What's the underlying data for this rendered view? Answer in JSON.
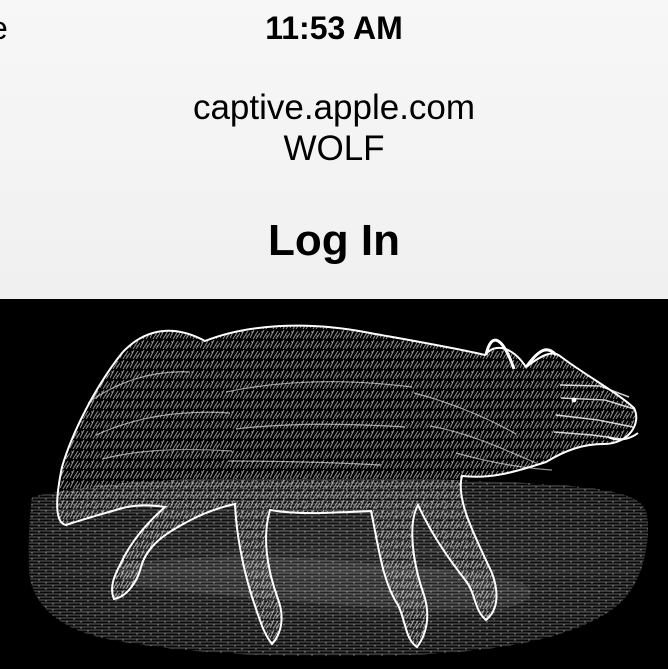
{
  "status_bar": {
    "time": "11:53 AM",
    "left_clip": "e"
  },
  "portal": {
    "domain": "captive.apple.com",
    "network_name": "WOLF",
    "title": "Log In",
    "back_icon": "chevron-left-icon"
  },
  "page_image": {
    "subject": "wolf-illustration",
    "background_color": "#000000",
    "foreground_color": "#ffffff"
  }
}
